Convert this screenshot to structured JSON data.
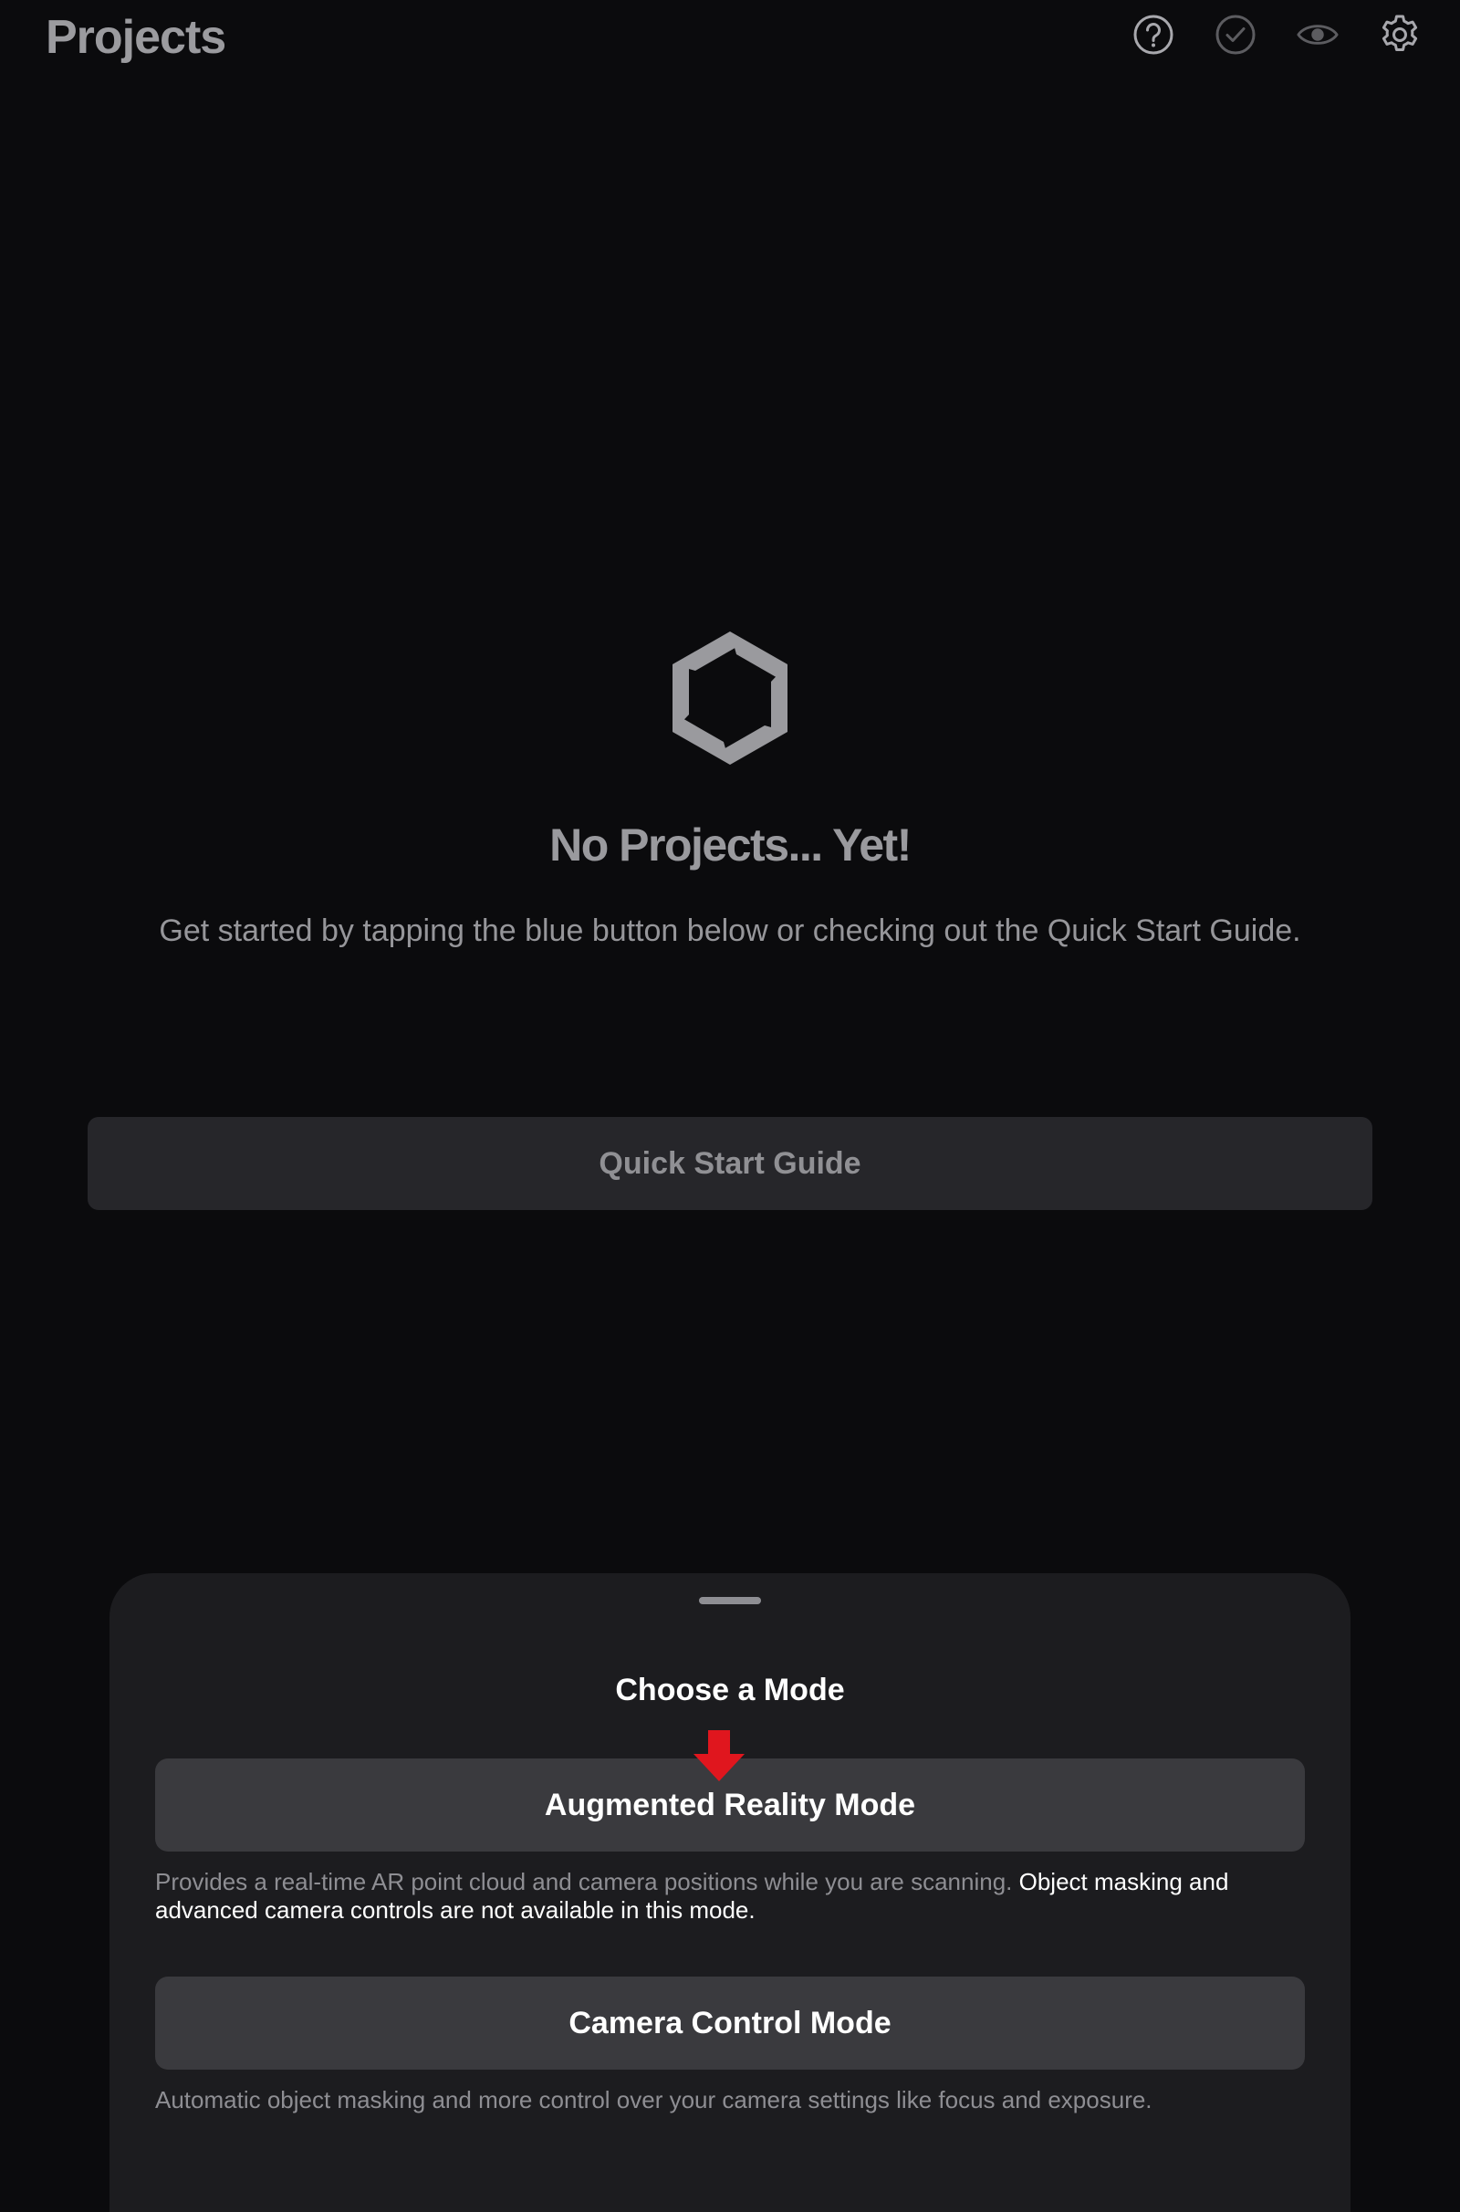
{
  "header": {
    "title": "Projects",
    "icons": [
      "help-icon",
      "checkmark-icon",
      "eye-icon",
      "settings-gear-icon"
    ]
  },
  "empty_state": {
    "logo": "aperture-logo",
    "title": "No Projects... Yet!",
    "description": "Get started by tapping the blue button below or checking out the Quick Start Guide."
  },
  "quick_start": {
    "label": "Quick Start Guide"
  },
  "mode_sheet": {
    "title": "Choose a Mode",
    "ar_mode": {
      "label": "Augmented Reality Mode",
      "description_dim": "Provides a real-time AR point cloud and camera positions while you are scanning.",
      "description_strong": "Object masking and advanced camera controls are not available in this mode."
    },
    "camera_mode": {
      "label": "Camera Control Mode",
      "description": "Automatic object masking and more control over your camera settings like focus and exposure."
    }
  },
  "colors": {
    "background": "#0b0b0d",
    "sheet": "#1c1c1f",
    "button": "#3a3a3e",
    "quick_start_button": "#26262a",
    "annotation_arrow": "#e0161e"
  }
}
